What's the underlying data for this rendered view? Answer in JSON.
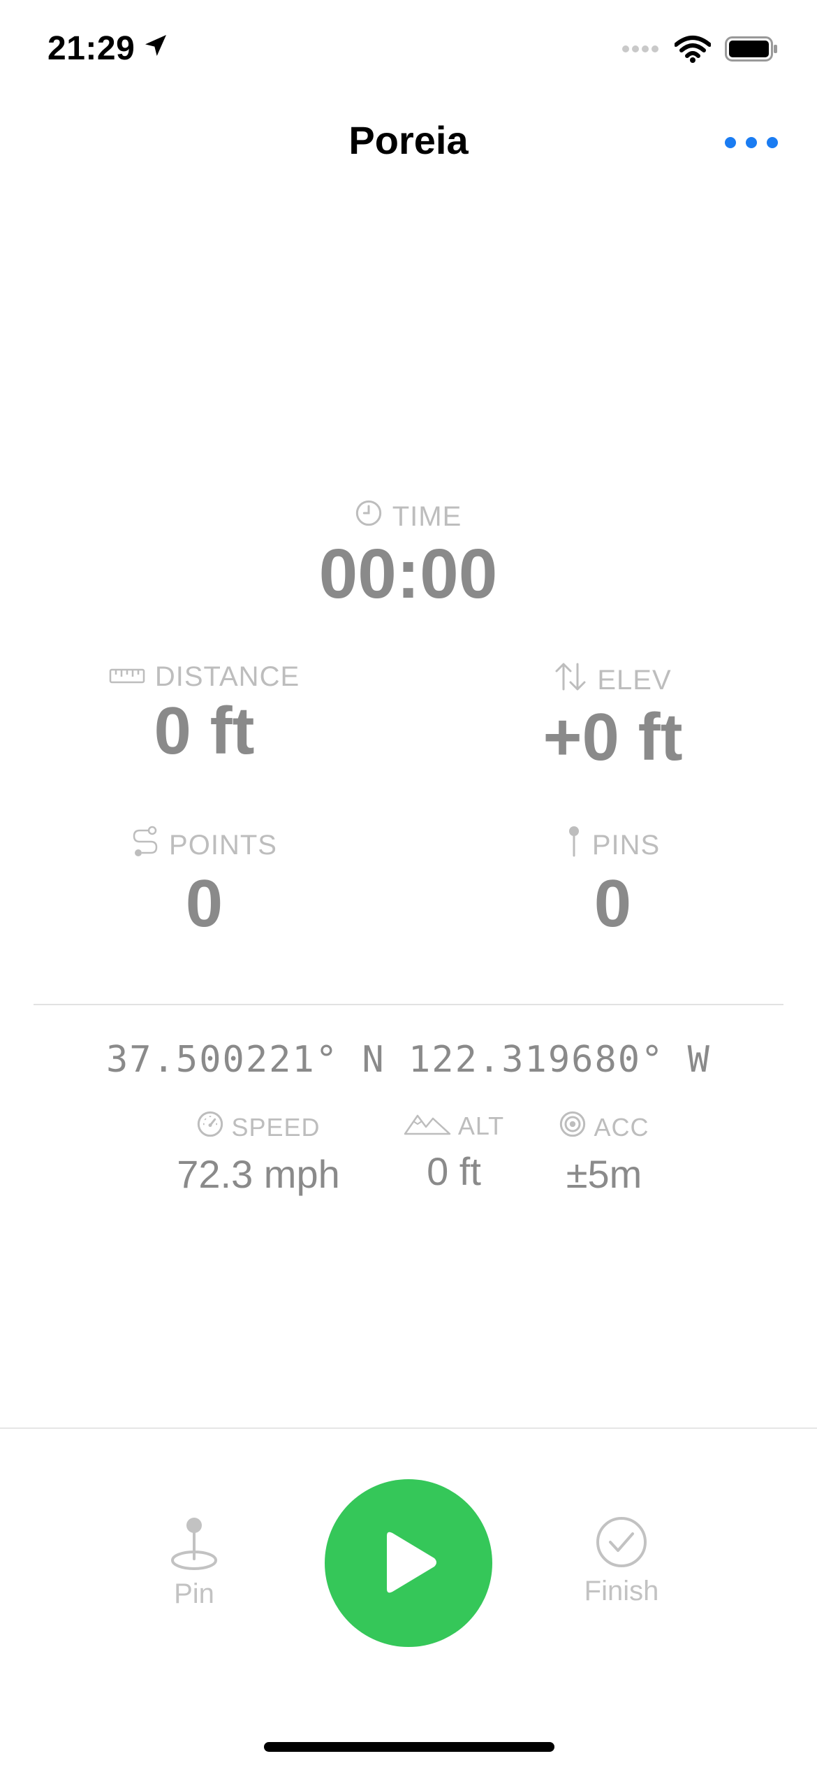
{
  "status_bar": {
    "time": "21:29",
    "icons": [
      "location-arrow-icon",
      "cellular-dots-icon",
      "wifi-icon",
      "battery-icon"
    ]
  },
  "nav": {
    "title": "Poreia",
    "more_icon": "ellipsis-icon"
  },
  "stats": {
    "time": {
      "label": "TIME",
      "value": "00:00",
      "icon": "clock-icon"
    },
    "distance": {
      "label": "DISTANCE",
      "value": "0 ft",
      "icon": "ruler-icon"
    },
    "elev": {
      "label": "ELEV",
      "value": "+0 ft",
      "icon": "up-down-arrows-icon"
    },
    "points": {
      "label": "POINTS",
      "value": "0",
      "icon": "route-icon"
    },
    "pins": {
      "label": "PINS",
      "value": "0",
      "icon": "pin-icon"
    }
  },
  "location": {
    "coordinates": "37.500221° N 122.319680° W",
    "speed": {
      "label": "SPEED",
      "value": "72.3 mph",
      "icon": "speedometer-icon"
    },
    "alt": {
      "label": "ALT",
      "value": "0 ft",
      "icon": "mountains-icon"
    },
    "acc": {
      "label": "ACC",
      "value": "±5m",
      "icon": "target-icon"
    }
  },
  "toolbar": {
    "pin_label": "Pin",
    "finish_label": "Finish",
    "play_icon": "play-icon"
  },
  "colors": {
    "accent_blue": "#1a7cf2",
    "play_green": "#35c759",
    "value_gray": "#8a8a8a",
    "label_gray": "#bdbdbd"
  }
}
